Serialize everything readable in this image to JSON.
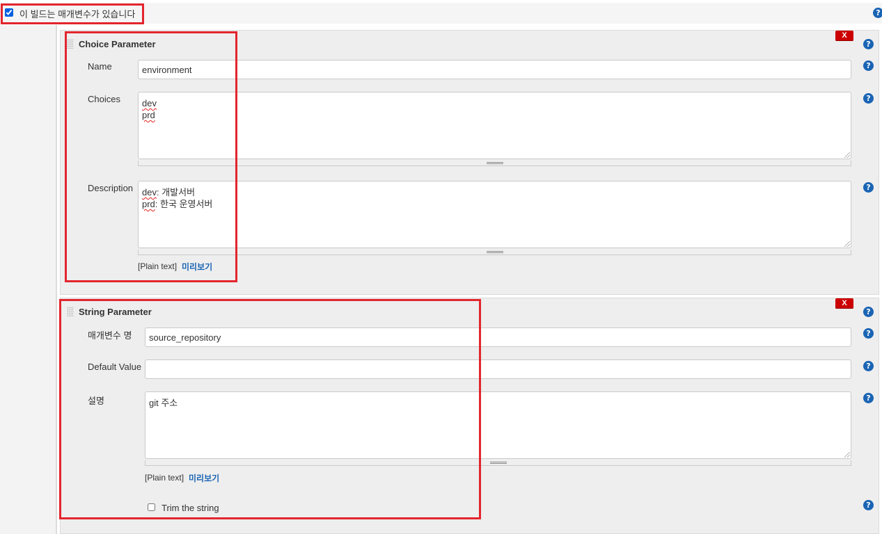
{
  "top": {
    "checkbox_label": "이 빌드는 매개변수가 있습니다",
    "checked": true
  },
  "icons": {
    "help": "question-mark-icon",
    "delete": "delete-x-icon",
    "drag": "drag-handle-icon"
  },
  "colors": {
    "accent": "#1a64b4",
    "danger": "#cc0000",
    "highlight": "#e3252d"
  },
  "choice_param": {
    "title": "Choice Parameter",
    "delete_label": "X",
    "name_label": "Name",
    "name_value": "environment",
    "choices_label": "Choices",
    "choices": [
      "dev",
      "prd"
    ],
    "description_label": "Description",
    "description_lines": [
      {
        "word": "dev",
        "rest": ": 개발서버"
      },
      {
        "word": "prd",
        "rest": ": 한국 운영서버"
      }
    ],
    "plain_text": "[Plain text]",
    "preview": "미리보기"
  },
  "string_param": {
    "title": "String Parameter",
    "delete_label": "X",
    "name_label": "매개변수 명",
    "name_value": "source_repository",
    "default_label": "Default Value",
    "default_value": "",
    "description_label": "설명",
    "description_value": "git 주소",
    "plain_text": "[Plain text]",
    "preview": "미리보기",
    "trim_label": "Trim the string",
    "trim_checked": false
  },
  "help_symbol": "?"
}
